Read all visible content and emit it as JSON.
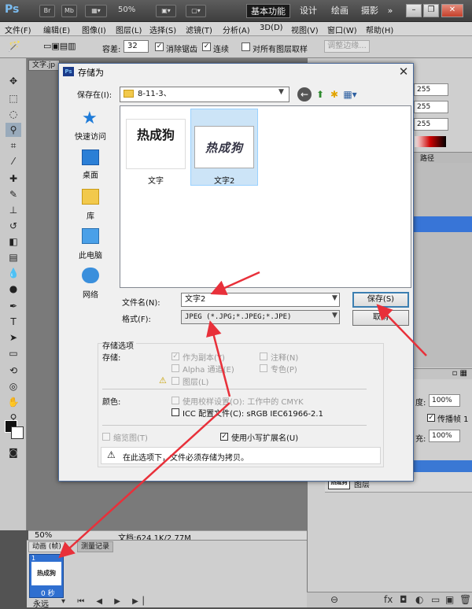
{
  "ps": {
    "logo": "Ps",
    "top_buttons": [
      "Br",
      "Mb"
    ],
    "zoom": "50%",
    "workspaces": [
      "基本功能",
      "设计",
      "绘画",
      "摄影"
    ],
    "more": "»"
  },
  "menu": [
    "文件(F)",
    "编辑(E)",
    "图像(I)",
    "图层(L)",
    "选择(S)",
    "滤镜(T)",
    "分析(A)",
    "3D(D)",
    "视图(V)",
    "窗口(W)",
    "帮助(H)"
  ],
  "options": {
    "tolerance_label": "容差:",
    "tolerance_value": "32",
    "antialias": "消除锯齿",
    "contiguous": "连续",
    "sample_all": "对所有图层取样",
    "refine": "调整边缘..."
  },
  "document": {
    "tab": "文字.jp",
    "zoom": "50%",
    "info": "文档:624.1K/2.77M"
  },
  "animation": {
    "tabs": [
      "动画 (帧)",
      "测量记录"
    ],
    "frame_num": "1",
    "frame_time": "0 秒",
    "loop": "永远"
  },
  "right": {
    "rgb": [
      "255",
      "255",
      "255"
    ],
    "tab_label": "路径",
    "opacity_label": "度:",
    "opacity_value": "100%",
    "propagate": "传播帧 1",
    "fill_label": "充:",
    "fill_value": "100%",
    "layer_name": "图层"
  },
  "dialog": {
    "title": "存储为",
    "save_in_label": "保存在(I):",
    "save_in_value": "8-11-3、",
    "places": [
      "快速访问",
      "桌面",
      "库",
      "此电脑",
      "网络"
    ],
    "files": [
      {
        "name": "文字",
        "thumb": "热成狗"
      },
      {
        "name": "文字2",
        "thumb": "热成狗"
      }
    ],
    "filename_label": "文件名(N):",
    "filename_value": "文字2",
    "format_label": "格式(F):",
    "format_value": "JPEG (*.JPG;*.JPEG;*.JPE)",
    "save_btn": "保存(S)",
    "cancel_btn": "取消",
    "options_title": "存储选项",
    "storage_label": "存储:",
    "as_copy": "作为副本(Y)",
    "notes": "注释(N)",
    "alpha": "Alpha 通道(E)",
    "spot": "专色(P)",
    "layers": "图层(L)",
    "color_label": "颜色:",
    "proof": "使用校样设置(O): 工作中的 CMYK",
    "icc": "ICC 配置文件(C): sRGB IEC61966-2.1",
    "thumbnail": "缩览图(T)",
    "lowercase": "使用小写扩展名(U)",
    "warning": "在此选项下，文件必须存储为拷贝。"
  },
  "colors": {
    "accent": "#3875d7",
    "arrow": "#e8303a"
  }
}
